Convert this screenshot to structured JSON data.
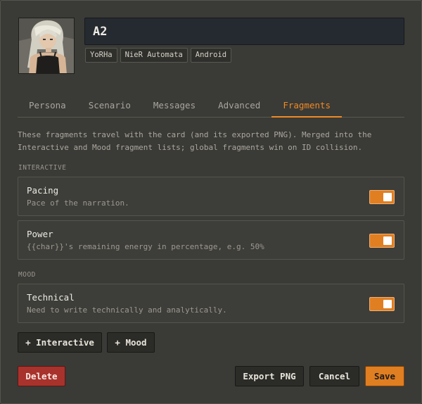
{
  "character": {
    "name": "A2",
    "tags": [
      "YoRHa",
      "NieR Automata",
      "Android"
    ]
  },
  "tabs": [
    {
      "label": "Persona",
      "active": false
    },
    {
      "label": "Scenario",
      "active": false
    },
    {
      "label": "Messages",
      "active": false
    },
    {
      "label": "Advanced",
      "active": false
    },
    {
      "label": "Fragments",
      "active": true
    }
  ],
  "fragments": {
    "description_line1": "These fragments travel with the card (and its exported PNG). Merged into the",
    "description_line2": "Interactive and Mood fragment lists; global fragments win on ID collision.",
    "interactive_label": "INTERACTIVE",
    "mood_label": "MOOD",
    "interactive": [
      {
        "title": "Pacing",
        "description": "Pace of the narration.",
        "enabled": true
      },
      {
        "title": "Power",
        "description": "{{char}}'s remaining energy in percentage, e.g. 50%",
        "enabled": true
      }
    ],
    "mood": [
      {
        "title": "Technical",
        "description": "Need to write technically and analytically.",
        "enabled": true
      }
    ],
    "add_interactive_label": "+ Interactive",
    "add_mood_label": "+ Mood"
  },
  "actions": {
    "delete_label": "Delete",
    "export_label": "Export PNG",
    "cancel_label": "Cancel",
    "save_label": "Save"
  },
  "colors": {
    "accent": "#f08a24",
    "background": "#3a3a36",
    "danger": "#a8332c",
    "input_bg": "#252a30"
  }
}
